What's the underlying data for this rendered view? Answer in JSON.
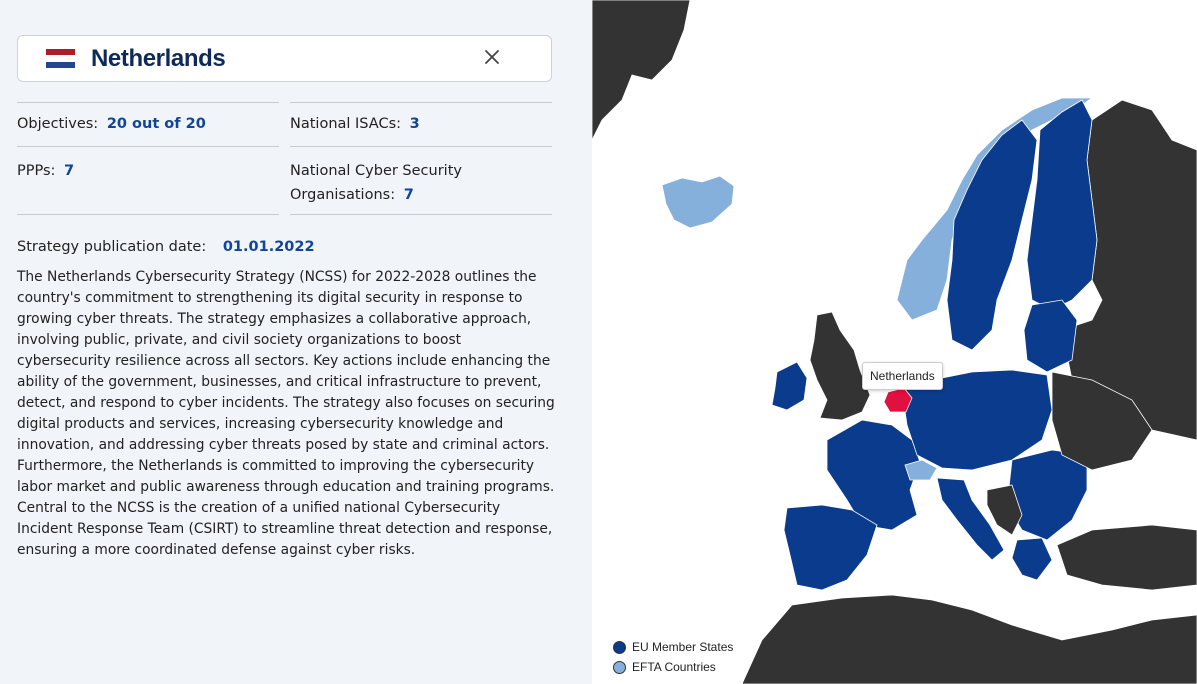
{
  "header": {
    "country": "Netherlands",
    "flag_colors": [
      "#ae1c28",
      "#ffffff",
      "#21468b"
    ],
    "close_icon": "close-icon"
  },
  "stats": {
    "objectives": {
      "label": "Objectives:",
      "value": "20 out of 20"
    },
    "isacs": {
      "label": "National ISACs:",
      "value": "3"
    },
    "ppps": {
      "label": "PPPs:",
      "value": "7"
    },
    "ncso": {
      "label_line1": "National Cyber Security",
      "label_line2": "Organisations:",
      "value": "7"
    }
  },
  "strategy": {
    "date_label": "Strategy publication date:",
    "date_value": "01.01.2022",
    "description": "The Netherlands Cybersecurity Strategy (NCSS) for 2022-2028 outlines the country's commitment to strengthening its digital security in response to growing cyber threats. The strategy emphasizes a collaborative approach, involving public, private, and civil society organizations to boost cybersecurity resilience across all sectors. Key actions include enhancing the ability of the government, businesses, and critical infrastructure to prevent, detect, and respond to cyber incidents. The strategy also focuses on securing digital products and services, increasing cybersecurity knowledge and innovation, and addressing cyber threats posed by state and criminal actors. Furthermore, the Netherlands is committed to improving the cybersecurity labor market and public awareness through education and training programs. Central to the NCSS is the creation of a unified national Cybersecurity Incident Response Team (CSIRT) to streamline threat detection and response, ensuring a more coordinated defense against cyber risks."
  },
  "map": {
    "tooltip": "Netherlands",
    "legend": [
      {
        "label": "EU Member States",
        "color": "#0b3b8c"
      },
      {
        "label": "EFTA Countries",
        "color": "#86b0dc"
      }
    ],
    "colors": {
      "eu": "#0b3b8c",
      "efta": "#86b0dc",
      "selected": "#e0103f",
      "other": "#333333",
      "sea": "#ffffff"
    }
  }
}
